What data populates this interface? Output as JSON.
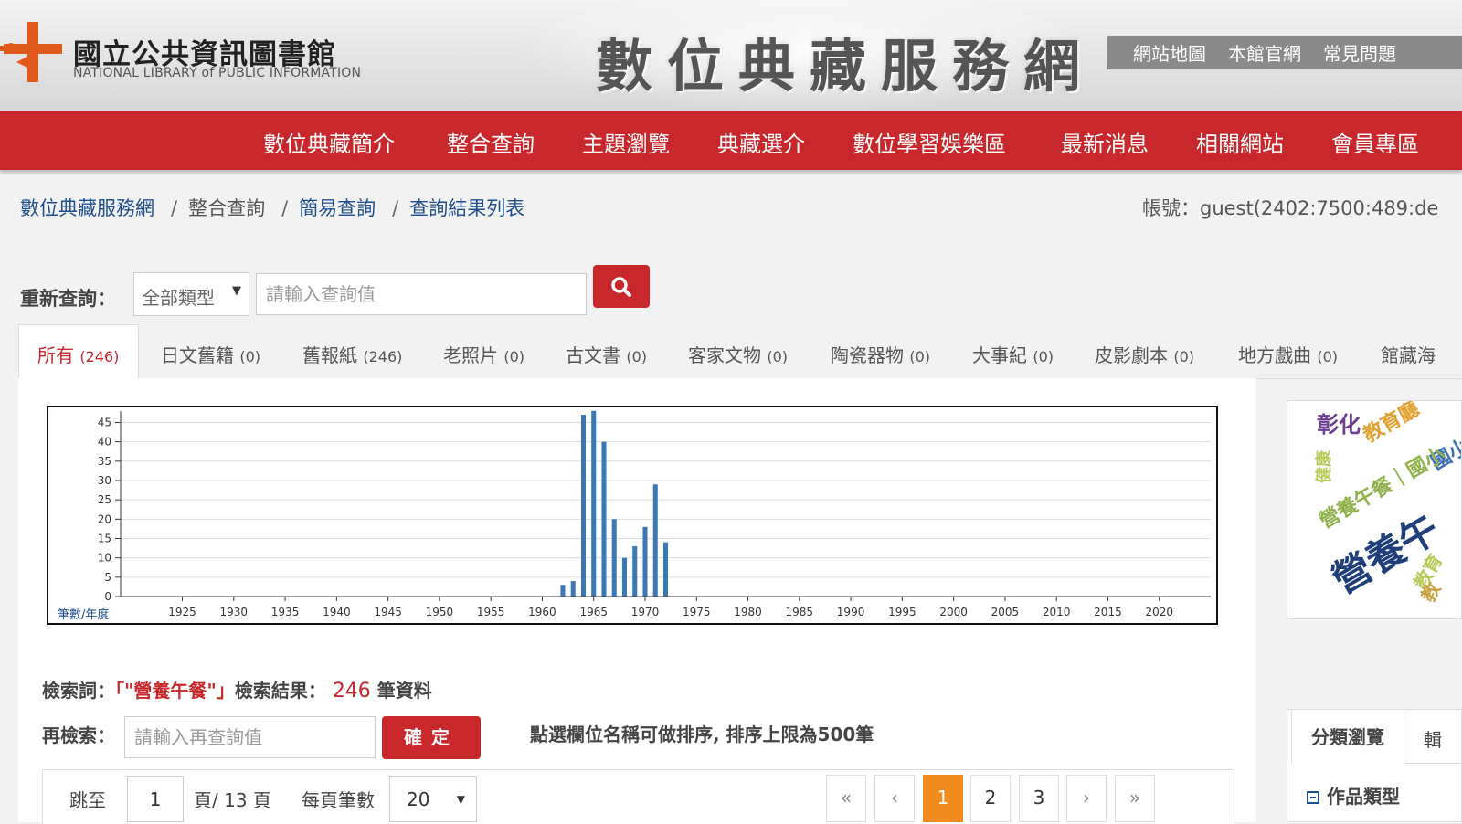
{
  "header": {
    "logo_zh": "國立公共資訊圖書館",
    "logo_en": "NATIONAL LIBRARY of PUBLIC INFORMATION",
    "site_title": "數位典藏服務網",
    "top_links": [
      "網站地圖",
      "本館官網",
      "常見問題"
    ]
  },
  "nav": [
    "數位典藏簡介",
    "整合查詢",
    "主題瀏覽",
    "典藏選介",
    "數位學習娛樂區",
    "最新消息",
    "相關網站",
    "會員專區"
  ],
  "breadcrumb": [
    "數位典藏服務網",
    "整合查詢",
    "簡易查詢",
    "查詢結果列表"
  ],
  "account": "帳號：guest(2402:7500:489:de",
  "search": {
    "label": "重新查詢：",
    "type_selected": "全部類型",
    "placeholder": "請輸入查詢值"
  },
  "tabs": [
    {
      "label": "所有",
      "count": "(246)"
    },
    {
      "label": "日文舊籍",
      "count": "(0)"
    },
    {
      "label": "舊報紙",
      "count": "(246)"
    },
    {
      "label": "老照片",
      "count": "(0)"
    },
    {
      "label": "古文書",
      "count": "(0)"
    },
    {
      "label": "客家文物",
      "count": "(0)"
    },
    {
      "label": "陶瓷器物",
      "count": "(0)"
    },
    {
      "label": "大事紀",
      "count": "(0)"
    },
    {
      "label": "皮影劇本",
      "count": "(0)"
    },
    {
      "label": "地方戲曲",
      "count": "(0)"
    },
    {
      "label": "館藏海",
      "count": ""
    }
  ],
  "chart_data": {
    "type": "bar",
    "ylabel": "筆數/年度",
    "ylim": [
      0,
      47
    ],
    "yticks": [
      0,
      5,
      10,
      15,
      20,
      25,
      30,
      35,
      40,
      45
    ],
    "xlim": [
      1919,
      2025
    ],
    "xticks": [
      1925,
      1930,
      1935,
      1940,
      1945,
      1950,
      1955,
      1960,
      1965,
      1970,
      1975,
      1980,
      1985,
      1990,
      1995,
      2000,
      2005,
      2010,
      2015,
      2020
    ],
    "x": [
      1962,
      1963,
      1964,
      1965,
      1966,
      1967,
      1968,
      1969,
      1970,
      1971,
      1972
    ],
    "values": [
      3,
      4,
      47,
      48,
      40,
      20,
      10,
      13,
      18,
      29,
      14
    ],
    "bar_color": "#3c78b4",
    "grid": true
  },
  "word_cloud": [
    {
      "text": "彰化",
      "color": "#6b3f8f"
    },
    {
      "text": "教育廳",
      "color": "#e0a030"
    },
    {
      "text": "國小",
      "color": "#3a6fb0"
    },
    {
      "text": "健康",
      "color": "#b8c85a"
    },
    {
      "text": "營養午餐｜國小",
      "color": "#8fb04a"
    },
    {
      "text": "營養午",
      "color": "#1f3f7a"
    },
    {
      "text": "教育",
      "color": "#b8c85a"
    },
    {
      "text": "教",
      "color": "#c8a040"
    }
  ],
  "results": {
    "term_label": "檢索詞：",
    "term": "「\"營養午餐\"」",
    "result_label": "檢索結果：",
    "count": "246",
    "unit": "筆資料",
    "research_label": "再檢索：",
    "research_placeholder": "請輸入再查詢值",
    "confirm": "確定",
    "sort_note": "點選欄位名稱可做排序, 排序上限為500筆"
  },
  "pager": {
    "jump_label": "跳至",
    "page_value": "1",
    "page_of": "頁/ 13 頁",
    "per_page_label": "每頁筆數",
    "per_page_value": "20",
    "first": "«",
    "prev": "‹",
    "pages": [
      "1",
      "2",
      "3"
    ],
    "next": "›",
    "last": "»"
  },
  "side": {
    "tab_active": "分類瀏覽",
    "tab_2": "輯",
    "facet": "作品類型"
  }
}
